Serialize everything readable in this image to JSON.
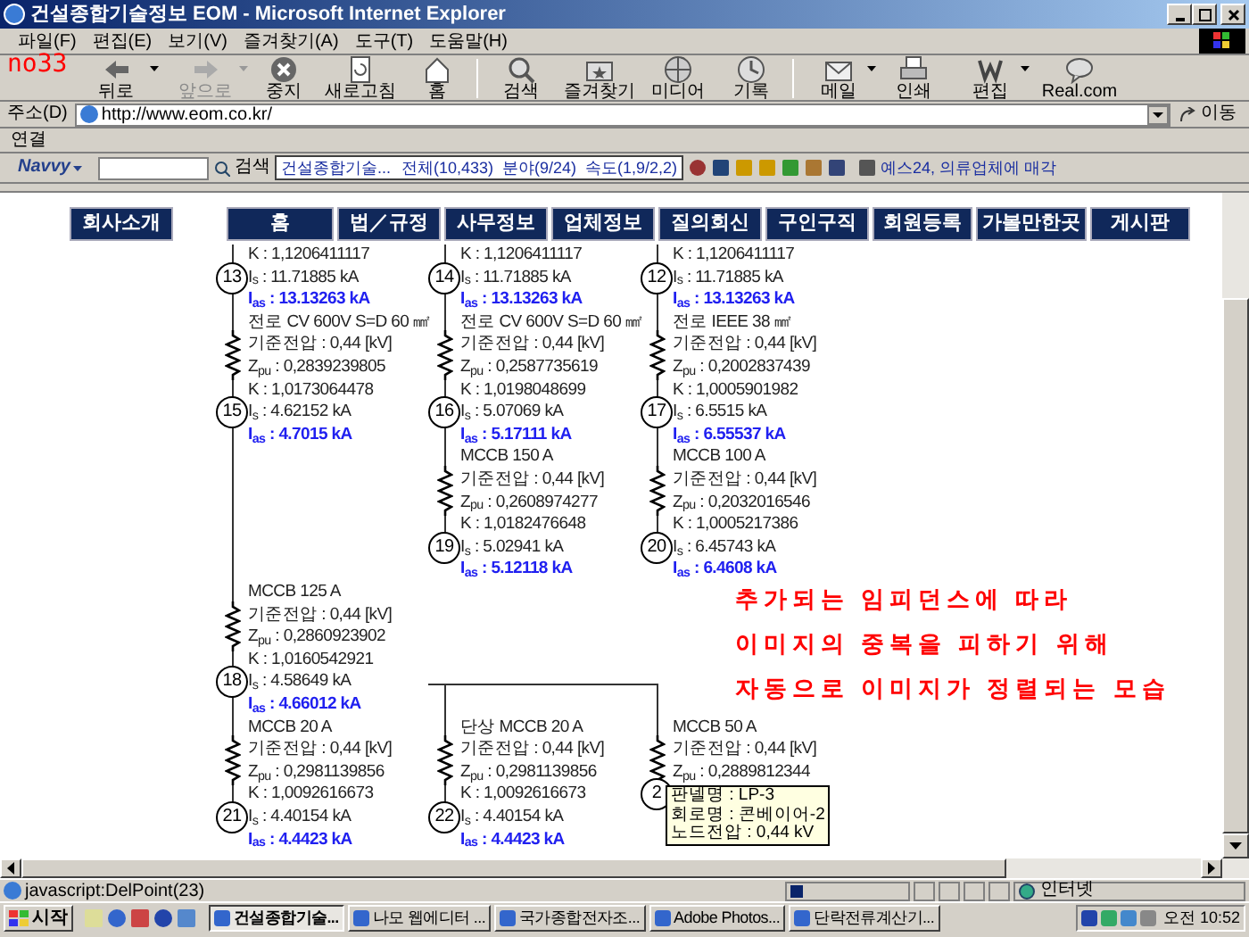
{
  "window": {
    "title": "건설종합기술정보 EOM - Microsoft Internet Explorer"
  },
  "menu": [
    "파일(F)",
    "편집(E)",
    "보기(V)",
    "즐겨찾기(A)",
    "도구(T)",
    "도움말(H)"
  ],
  "corner_note": "no33",
  "toolbar": [
    {
      "label": "뒤로",
      "disabled": false,
      "dropdown": true
    },
    {
      "label": "앞으로",
      "disabled": true,
      "dropdown": true
    },
    {
      "label": "중지",
      "disabled": false,
      "dropdown": false
    },
    {
      "label": "새로고침",
      "disabled": false,
      "dropdown": false
    },
    {
      "label": "홈",
      "disabled": false,
      "dropdown": false
    },
    {
      "label": "검색",
      "disabled": false,
      "dropdown": false
    },
    {
      "label": "즐겨찾기",
      "disabled": false,
      "dropdown": false
    },
    {
      "label": "미디어",
      "disabled": false,
      "dropdown": false
    },
    {
      "label": "기록",
      "disabled": false,
      "dropdown": false
    },
    {
      "label": "메일",
      "disabled": false,
      "dropdown": true
    },
    {
      "label": "인쇄",
      "disabled": false,
      "dropdown": false
    },
    {
      "label": "편집",
      "disabled": false,
      "dropdown": true
    },
    {
      "label": "Real.com",
      "disabled": false,
      "dropdown": false
    }
  ],
  "address": {
    "label": "주소(D)",
    "value": "http://www.eom.co.kr/",
    "go": "이동"
  },
  "links": {
    "label": "연결"
  },
  "navvy": {
    "brand": "Navvy",
    "search_button": "검색",
    "site": "건설종합기술...",
    "stats": "전체(10,433)  분야(9/24)  속도(1,9/2,2)",
    "news": "예스24, 의류업체에 매각"
  },
  "site_nav": [
    "회사소개",
    "홈",
    "법／규정",
    "사무정보",
    "업체정보",
    "질의회신",
    "구인구직",
    "회원등록",
    "가볼만한곳",
    "게시판"
  ],
  "diagram": {
    "columns": [
      {
        "groups": [
          {
            "rows": [
              {
                "kind": "text",
                "text": "K : 1,1206411117"
              },
              {
                "kind": "node",
                "number": "13",
                "text": "I$_{s}$ : 11.71885 kA"
              },
              {
                "kind": "current",
                "text": "I$_{as}$ : 13.13263 kA"
              },
              {
                "kind": "text",
                "text": "전로 CV 600V S=D 60 ㎟"
              },
              {
                "kind": "text",
                "text": "기준전압 : 0,44 [kV]",
                "coil": true
              },
              {
                "kind": "text",
                "text": "Z$_{pu}$ : 0,2839239805"
              },
              {
                "kind": "text",
                "text": "K : 1,0173064478"
              },
              {
                "kind": "node",
                "number": "15",
                "text": "I$_{s}$ : 4.62152 kA"
              },
              {
                "kind": "current",
                "text": "I$_{as}$ : 4.7015 kA"
              }
            ]
          },
          {
            "rows": [
              {
                "kind": "text",
                "text": "MCCB 125 A"
              },
              {
                "kind": "text",
                "text": "기준전압 : 0,44 [kV]",
                "coil": true
              },
              {
                "kind": "text",
                "text": "Z$_{pu}$ : 0,2860923902"
              },
              {
                "kind": "text",
                "text": "K : 1,0160542921"
              },
              {
                "kind": "node",
                "number": "18",
                "text": "I$_{s}$ : 4.58649 kA"
              },
              {
                "kind": "current",
                "text": "I$_{as}$ : 4.66012 kA"
              },
              {
                "kind": "text",
                "text": "MCCB 20 A"
              },
              {
                "kind": "text",
                "text": "기준전압 : 0,44 [kV]",
                "coil": true
              },
              {
                "kind": "text",
                "text": "Z$_{pu}$ : 0,2981139856"
              },
              {
                "kind": "text",
                "text": "K : 1,0092616673"
              },
              {
                "kind": "node",
                "number": "21",
                "text": "I$_{s}$ : 4.40154 kA"
              },
              {
                "kind": "current",
                "text": "I$_{as}$ : 4.4423 kA"
              }
            ]
          }
        ]
      },
      {
        "groups": [
          {
            "rows": [
              {
                "kind": "text",
                "text": "K : 1,1206411117"
              },
              {
                "kind": "node",
                "number": "14",
                "text": "I$_{s}$ : 11.71885 kA"
              },
              {
                "kind": "current",
                "text": "I$_{as}$ : 13.13263 kA"
              },
              {
                "kind": "text",
                "text": "전로 CV 600V S=D 60 ㎟"
              },
              {
                "kind": "text",
                "text": "기준전압 : 0,44 [kV]",
                "coil": true
              },
              {
                "kind": "text",
                "text": "Z$_{pu}$ : 0,2587735619"
              },
              {
                "kind": "text",
                "text": "K : 1,0198048699"
              },
              {
                "kind": "node",
                "number": "16",
                "text": "I$_{s}$ : 5.07069 kA"
              },
              {
                "kind": "current",
                "text": "I$_{as}$ : 5.17111 kA"
              },
              {
                "kind": "text",
                "text": "MCCB 150 A"
              },
              {
                "kind": "text",
                "text": "기준전압 : 0,44 [kV]",
                "coil": true
              },
              {
                "kind": "text",
                "text": "Z$_{pu}$ : 0,2608974277"
              },
              {
                "kind": "text",
                "text": "K : 1,0182476648"
              },
              {
                "kind": "node",
                "number": "19",
                "text": "I$_{s}$ : 5.02941 kA"
              },
              {
                "kind": "current",
                "text": "I$_{as}$ : 5.12118 kA"
              }
            ]
          },
          {
            "rows": [
              {
                "kind": "text",
                "text": "단상 MCCB 20 A"
              },
              {
                "kind": "text",
                "text": "기준전압 : 0,44 [kV]",
                "coil": true
              },
              {
                "kind": "text",
                "text": "Z$_{pu}$ : 0,2981139856"
              },
              {
                "kind": "text",
                "text": "K : 1,0092616673"
              },
              {
                "kind": "node",
                "number": "22",
                "text": "I$_{s}$ : 4.40154 kA"
              },
              {
                "kind": "current",
                "text": "I$_{as}$ : 4.4423 kA"
              }
            ]
          }
        ]
      },
      {
        "groups": [
          {
            "rows": [
              {
                "kind": "text",
                "text": "K : 1,1206411117"
              },
              {
                "kind": "node",
                "number": "12",
                "text": "I$_{s}$ : 11.71885 kA"
              },
              {
                "kind": "current",
                "text": "I$_{as}$ : 13.13263 kA"
              },
              {
                "kind": "text",
                "text": "전로 IEEE 38 ㎟"
              },
              {
                "kind": "text",
                "text": "기준전압 : 0,44 [kV]",
                "coil": true
              },
              {
                "kind": "text",
                "text": "Z$_{pu}$ : 0,2002837439"
              },
              {
                "kind": "text",
                "text": "K : 1,0005901982"
              },
              {
                "kind": "node",
                "number": "17",
                "text": "I$_{s}$ : 6.5515 kA"
              },
              {
                "kind": "current",
                "text": "I$_{as}$ : 6.55537 kA"
              },
              {
                "kind": "text",
                "text": "MCCB 100 A"
              },
              {
                "kind": "text",
                "text": "기준전압 : 0,44 [kV]",
                "coil": true
              },
              {
                "kind": "text",
                "text": "Z$_{pu}$ : 0,2032016546"
              },
              {
                "kind": "text",
                "text": "K : 1,0005217386"
              },
              {
                "kind": "node",
                "number": "20",
                "text": "I$_{s}$ : 6.45743 kA"
              },
              {
                "kind": "current",
                "text": "I$_{as}$ : 6.4608 kA"
              }
            ]
          },
          {
            "rows": [
              {
                "kind": "text",
                "text": "MCCB 50 A"
              },
              {
                "kind": "text",
                "text": "기준전압 : 0,44 [kV]",
                "coil": true
              },
              {
                "kind": "text",
                "text": "Z$_{pu}$ : 0,2889812344"
              },
              {
                "kind": "node",
                "number": "2"
              }
            ]
          }
        ]
      }
    ],
    "tooltip": [
      "판넬명 : LP-3",
      "회로명 : 콘베이어-2",
      "노드전압 : 0,44 kV"
    ]
  },
  "annotation": [
    "추가되는 임피던스에 따라",
    "이미지의 중복을 피하기 위해",
    "자동으로 이미지가 정렬되는 모습"
  ],
  "status_bar": {
    "text": "javascript:DelPoint(23)",
    "zone": "인터넷"
  },
  "taskbar": {
    "start": "시작",
    "tasks": [
      {
        "label": "건설종합기술...",
        "selected": true
      },
      {
        "label": "나모 웹에디터 ...",
        "selected": false
      },
      {
        "label": "국가종합전자조...",
        "selected": false
      },
      {
        "label": "Adobe Photos...",
        "selected": false
      },
      {
        "label": "단락전류계산기...",
        "selected": false
      }
    ],
    "clock": "오전 10:52"
  }
}
